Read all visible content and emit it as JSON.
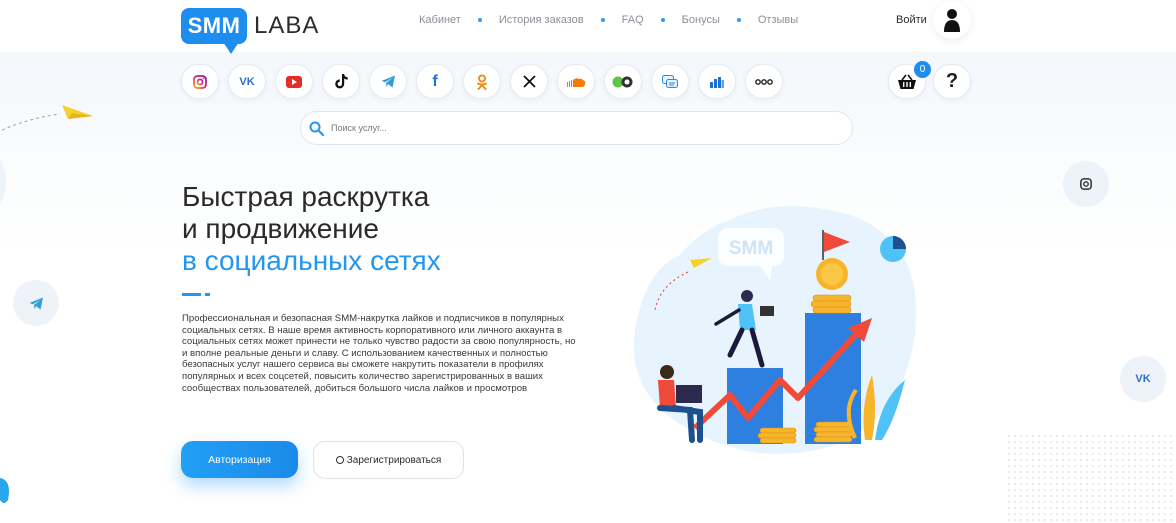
{
  "brand": {
    "logo_mark": "SMM",
    "logo_word": "LABA"
  },
  "nav": [
    "Кабинет",
    "История заказов",
    "FAQ",
    "Бонусы",
    "Отзывы"
  ],
  "header": {
    "login_label": "Войти",
    "avatar_icon": "user-icon"
  },
  "social_icons": [
    "instagram-icon",
    "vk-icon",
    "youtube-icon",
    "tiktok-icon",
    "telegram-icon",
    "facebook-icon",
    "odnoklassniki-icon",
    "x-twitter-icon",
    "soundcloud-icon",
    "twitch-icon",
    "chat-icon",
    "chart-icon",
    "more-icon"
  ],
  "cart": {
    "count": "0"
  },
  "help_label": "?",
  "search": {
    "placeholder": "Поиск услуг..."
  },
  "hero": {
    "line1": "Быстрая раскрутка",
    "line2": "и продвижение",
    "line3": "в социальных сетях",
    "description": "Профессиональная и безопасная SMM-накрутка лайков и подписчиков в популярных социальных сетях. В наше время активность корпоративного или личного аккаунта в социальных сетях может принести не только чувство радости за свою популярность, но и вполне реальные деньги и славу. С использованием качественных и полностью безопасных услуг нашего сервиса вы сможете накрутить показатели в профилях популярных и всех соцсетей, повысить количество зарегистрированных в ваших сообществах пользователей, добиться большого числа лайков и просмотров",
    "auth_button": "Авторизация",
    "register_button": "Зарегистрироваться"
  },
  "illustration": {
    "badge_text": "SMM"
  },
  "colors": {
    "accent": "#2196f3",
    "brand": "#1d8df0",
    "text": "#2a2a2a",
    "chart_red": "#f04a3a",
    "coin": "#f7b52c"
  }
}
